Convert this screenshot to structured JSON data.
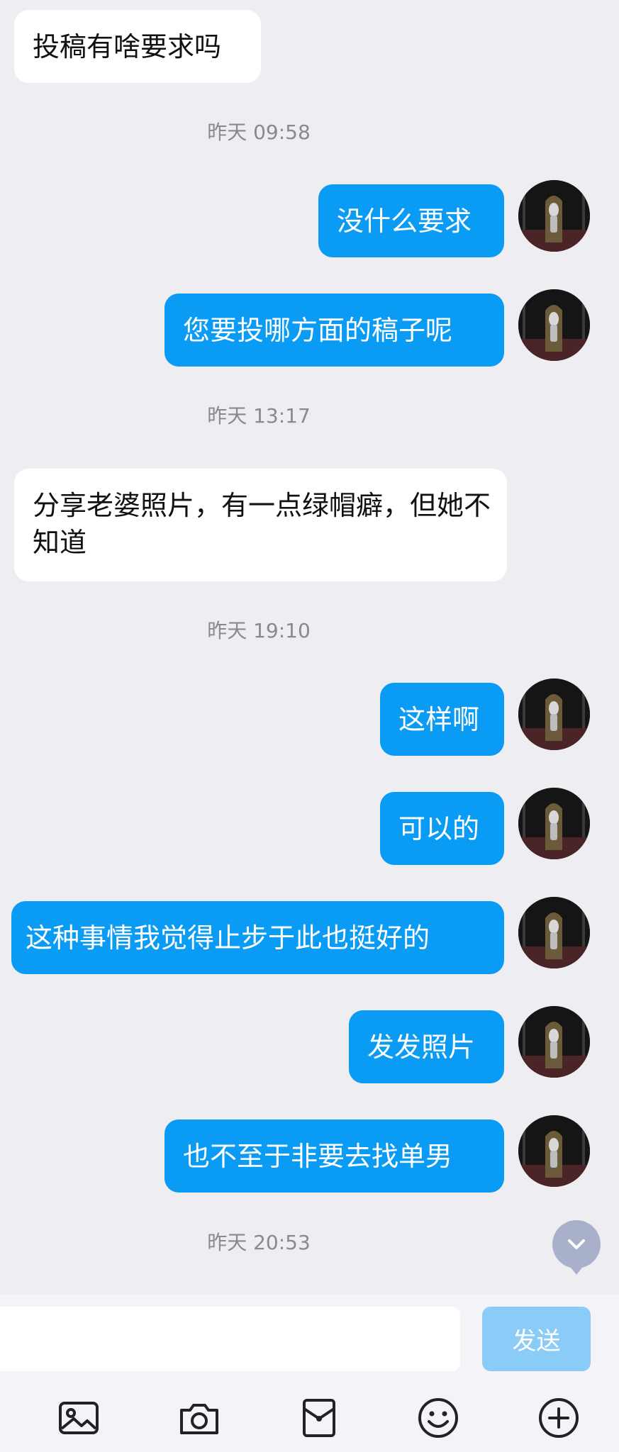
{
  "messages": [
    {
      "type": "in",
      "text": "投稿有啥要求吗"
    },
    {
      "type": "time",
      "text": "昨天 09:58"
    },
    {
      "type": "out",
      "text": "没什么要求"
    },
    {
      "type": "out",
      "text": "您要投哪方面的稿子呢"
    },
    {
      "type": "time",
      "text": "昨天 13:17"
    },
    {
      "type": "in",
      "text": "分享老婆照片，有一点绿帽癖，但她不知道"
    },
    {
      "type": "time",
      "text": "昨天 19:10"
    },
    {
      "type": "out",
      "text": "这样啊"
    },
    {
      "type": "out",
      "text": "可以的"
    },
    {
      "type": "out",
      "text": "这种事情我觉得止步于此也挺好的"
    },
    {
      "type": "out",
      "text": "发发照片"
    },
    {
      "type": "out",
      "text": "也不至于非要去找单男"
    },
    {
      "type": "time",
      "text": "昨天 20:53"
    }
  ],
  "composer": {
    "input_value": "",
    "send_label": "发送"
  },
  "toolbar": [
    "image-icon",
    "camera-icon",
    "red-packet-icon",
    "emoji-icon",
    "plus-icon"
  ],
  "colors": {
    "background": "#ededf2",
    "outgoing_bubble": "#0a9bf5",
    "incoming_bubble": "#ffffff",
    "send_button_disabled": "#8bcbf8",
    "scroll_badge": "#a9b0c9"
  }
}
